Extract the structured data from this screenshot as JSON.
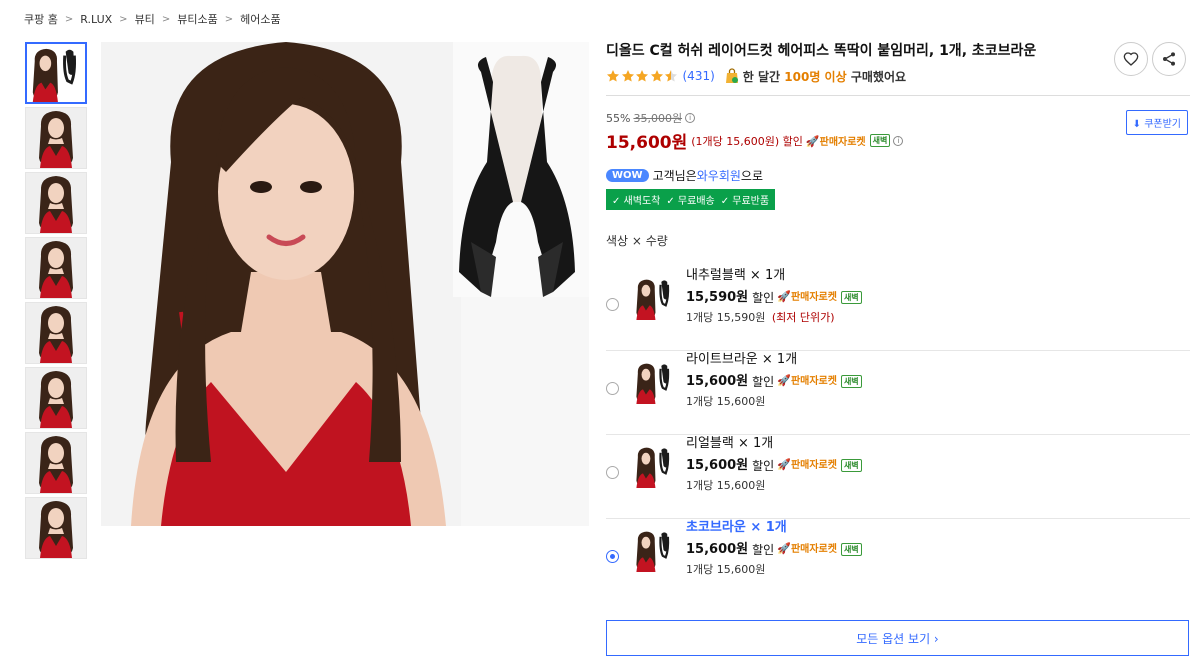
{
  "breadcrumb": [
    "쿠팡 홈",
    "R.LUX",
    "뷰티",
    "뷰티소품",
    "헤어소품"
  ],
  "product": {
    "title": "디올드 C컬 허쉬 레이어드컷 헤어피스 똑딱이 붙임머리, 1개, 초코브라운",
    "rating": 4.5,
    "review_count": "(431)",
    "buyers_prefix": "한 달간",
    "buyers_highlight": "100명 이상",
    "buyers_suffix": "구매했어요"
  },
  "price": {
    "discount_rate": "55%",
    "original_price": "35,000원",
    "sale_price": "15,600원",
    "unit_note": "(1개당 15,600원) 할인",
    "seller_rocket": "판매자로켓",
    "dawn_badge": "새벽",
    "coupon_label": "쿠폰받기"
  },
  "wow": {
    "badge": "WOW",
    "text_before": "고객님은 ",
    "link": "와우회원",
    "text_after": "으로",
    "benefits": [
      "✓ 새벽도착",
      "✓ 무료배송",
      "✓ 무료반품"
    ]
  },
  "option_label": "색상 × 수량",
  "options": [
    {
      "name": "내추럴블랙 × 1개",
      "price": "15,590원",
      "discount_label": "할인",
      "unit_price": "1개당 15,590원",
      "lowest": "(최저 단위가)",
      "selected": false
    },
    {
      "name": "라이트브라운 × 1개",
      "price": "15,600원",
      "discount_label": "할인",
      "unit_price": "1개당 15,600원",
      "lowest": "",
      "selected": false
    },
    {
      "name": "리얼블랙 × 1개",
      "price": "15,600원",
      "discount_label": "할인",
      "unit_price": "1개당 15,600원",
      "lowest": "",
      "selected": false
    },
    {
      "name": "초코브라운 × 1개",
      "price": "15,600원",
      "discount_label": "할인",
      "unit_price": "1개당 15,600원",
      "lowest": "",
      "selected": true
    }
  ],
  "all_options_label": "모든 옵션 보기 ›",
  "colors": {
    "accent": "#346aff",
    "price_red": "#ae0000",
    "rocket_orange": "#e47f00",
    "wow_green": "#0aa04a"
  },
  "icons": [
    "heart-icon",
    "share-icon",
    "star-icon",
    "info-icon",
    "download-icon",
    "rocket-icon",
    "shopping-bag-icon"
  ]
}
